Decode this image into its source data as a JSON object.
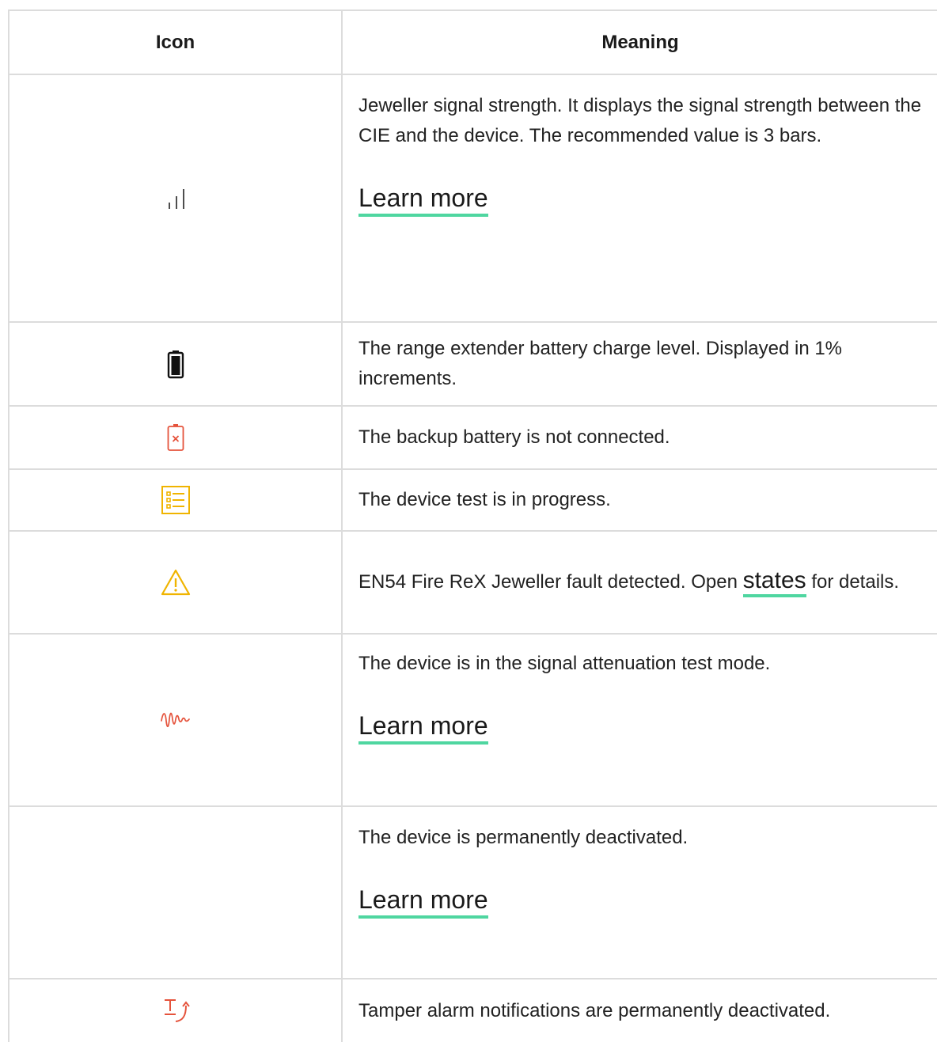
{
  "table": {
    "header": {
      "icon": "Icon",
      "meaning": "Meaning"
    },
    "rows": [
      {
        "icon": "signal-strength-icon",
        "text": "Jeweller signal strength. It displays the signal strength between the CIE and the device. The recommended value is 3 bars.",
        "link": "Learn more"
      },
      {
        "icon": "battery-icon",
        "text": "The range extender battery charge level. Displayed in 1% increments."
      },
      {
        "icon": "battery-disconnected-icon",
        "icon_color": "#e5533c",
        "text": "The backup battery is not connected."
      },
      {
        "icon": "device-test-list-icon",
        "icon_color": "#f0b400",
        "text": "The device test is in progress."
      },
      {
        "icon": "warning-triangle-icon",
        "icon_color": "#f0b400",
        "text_before": "EN54 Fire ReX Jeweller fault detected. Open",
        "link": "states",
        "text_after": "for details."
      },
      {
        "icon": "signal-attenuation-wave-icon",
        "icon_color": "#e5533c",
        "text": "The device is in the signal attenuation test mode.",
        "link": "Learn more"
      },
      {
        "icon": "",
        "text": "The device is permanently deactivated.",
        "link": "Learn more"
      },
      {
        "icon": "tamper-deactivated-icon",
        "icon_color": "#e5533c",
        "text": "Tamper alarm notifications are permanently deactivated."
      }
    ]
  },
  "colors": {
    "border": "#dcdcdc",
    "link_underline": "#4fd6a0",
    "red": "#e5533c",
    "yellow": "#f0b400"
  }
}
